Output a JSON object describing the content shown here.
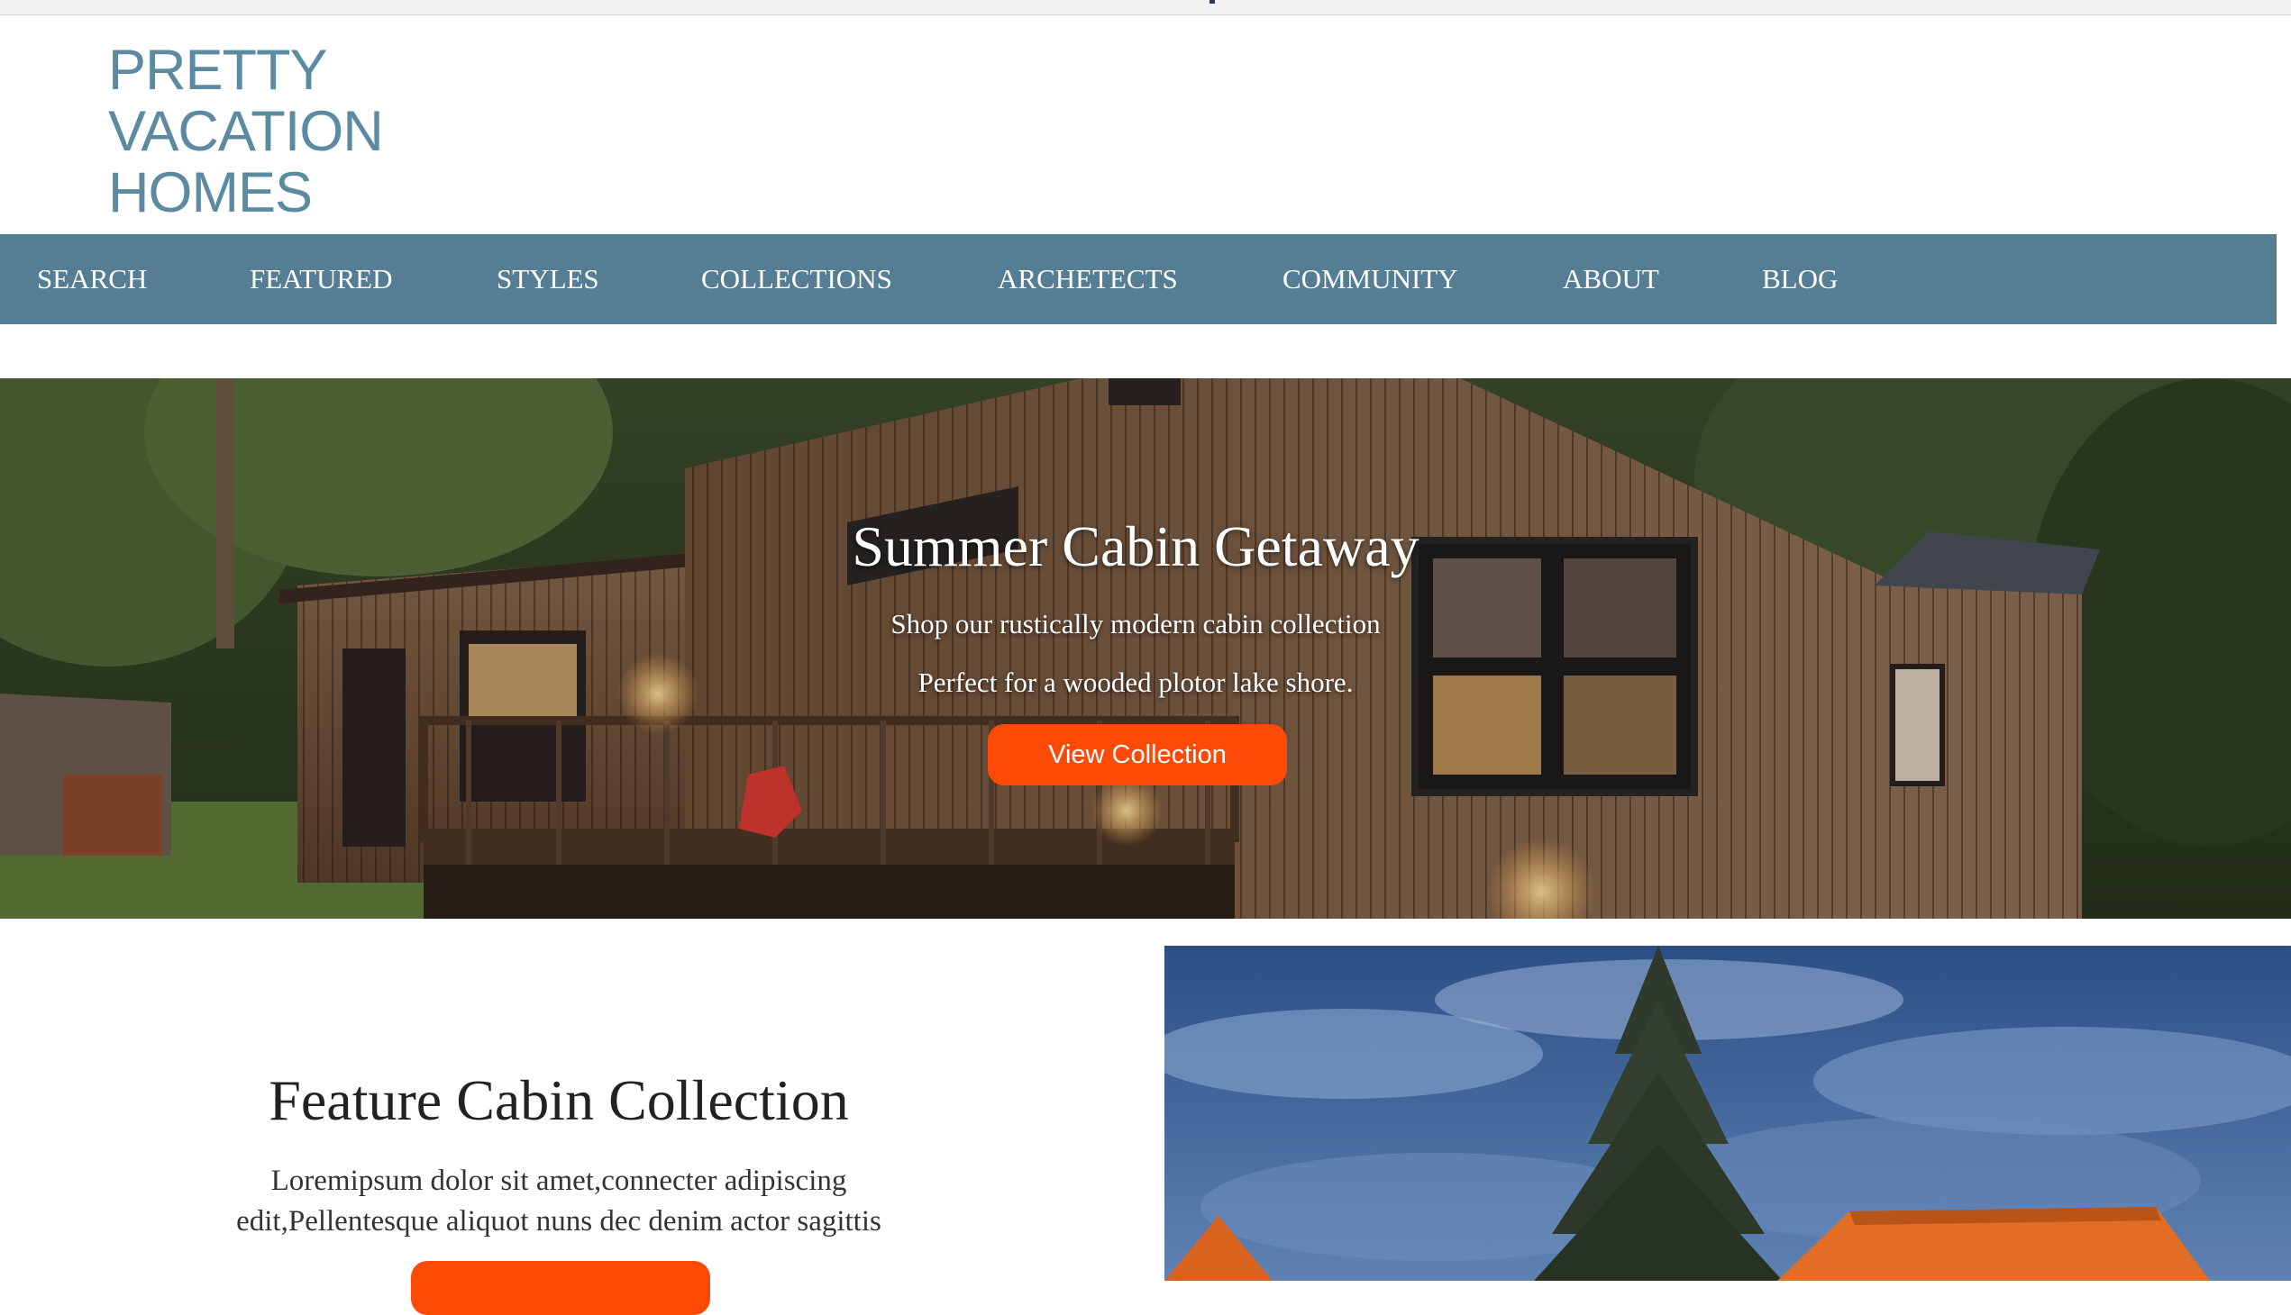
{
  "logo": {
    "lines": [
      "PRETTY",
      "VACATION",
      "HOMES"
    ]
  },
  "nav": {
    "items": [
      "SEARCH",
      "FEATURED",
      "STYLES",
      "COLLECTIONS",
      "ARCHETECTS",
      "COMMUNITY",
      "ABOUT",
      "BLOG"
    ],
    "background": "#557d93"
  },
  "hero": {
    "title": "Summer Cabin Getaway",
    "line1": "Shop our rustically modern cabin collection",
    "line2": "Perfect for a wooded plotor lake shore.",
    "button": "View Collection"
  },
  "feature": {
    "title": "Feature Cabin Collection",
    "line1": "Loremipsum dolor sit amet,connecter adipiscing",
    "line2": "edit,Pellentesque aliquot nuns dec denim actor sagittis"
  },
  "colors": {
    "accent": "#fd4a07",
    "logo": "#5c8aa0",
    "nav": "#557d93"
  }
}
